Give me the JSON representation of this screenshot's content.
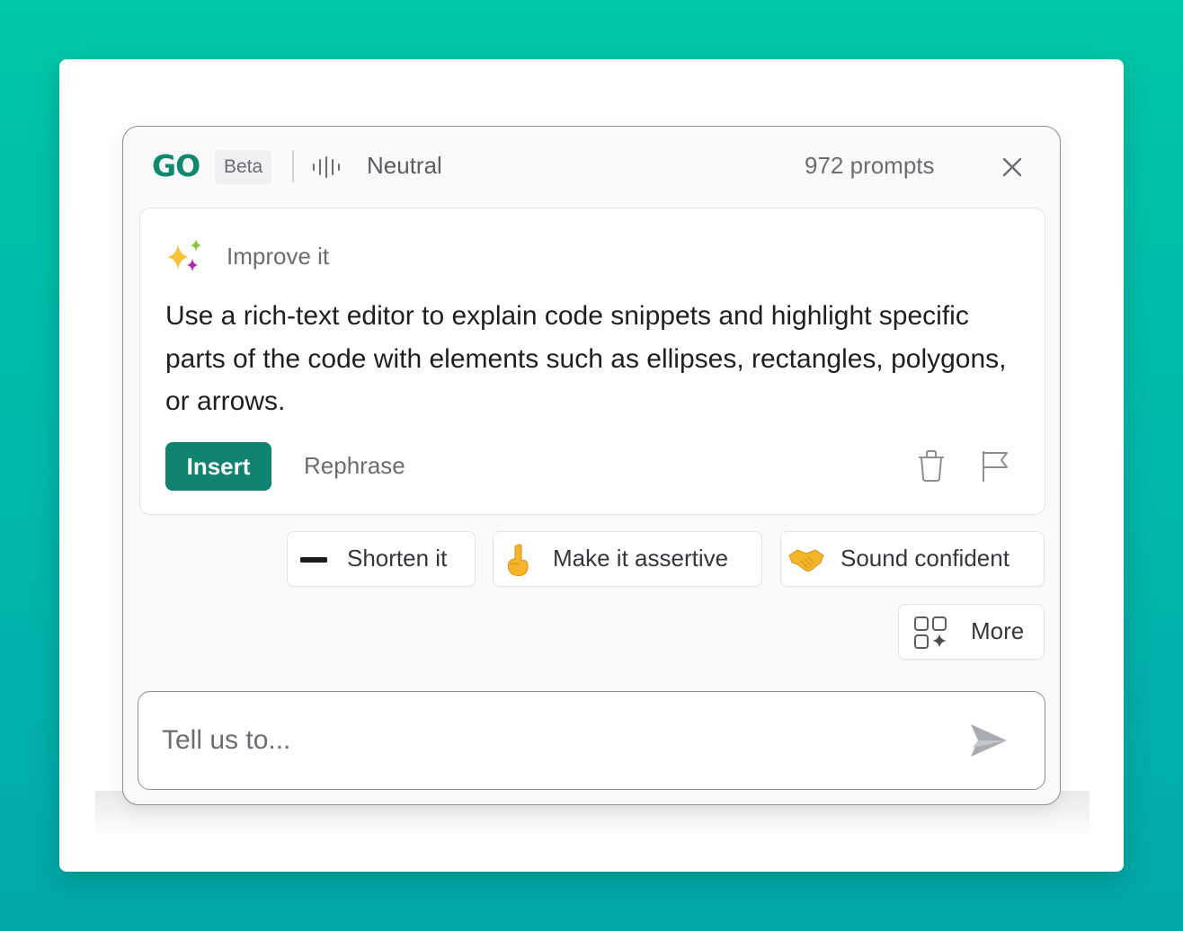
{
  "header": {
    "logo": "GO",
    "badge": "Beta",
    "tone_icon": "sound-wave-icon",
    "tone": "Neutral",
    "prompt_count": "972 prompts",
    "close_icon": "close-icon"
  },
  "suggestion": {
    "icon": "sparkles-icon",
    "title": "Improve it",
    "text": "Use a rich-text editor to explain code snippets and highlight specific parts of the code with elements such as ellipses, rectangles, polygons, or arrows.",
    "actions": {
      "insert_label": "Insert",
      "rephrase_label": "Rephrase",
      "delete_icon": "trash-icon",
      "report_icon": "flag-icon"
    }
  },
  "quick_actions": [
    {
      "icon": "minus-icon",
      "label": "Shorten it"
    },
    {
      "icon": "pointing-up-emoji-icon",
      "label": "Make it assertive"
    },
    {
      "icon": "handshake-emoji-icon",
      "label": "Sound confident"
    },
    {
      "icon": "grid-sparkle-icon",
      "label": "More"
    }
  ],
  "prompt_input": {
    "placeholder": "Tell us to...",
    "value": "",
    "send_icon": "send-icon"
  },
  "colors": {
    "brand": "#0d8a6e",
    "insert_button": "#0f8270",
    "background_top": "#00c7a9",
    "background_bottom": "#00a8a8"
  }
}
